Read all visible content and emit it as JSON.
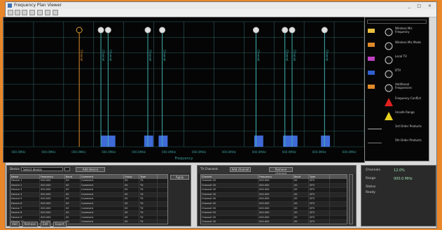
{
  "window": {
    "title": "Frequency Plan Viewer",
    "controls": "_ □ ×"
  },
  "toolbar": {
    "buttons": [
      "open-icon",
      "save-icon",
      "print-icon",
      "zoom-in-icon",
      "zoom-out-icon",
      "refresh-icon",
      "settings-icon"
    ]
  },
  "plot": {
    "x_axis_title": "Frequency",
    "tick_labels": [
      "000.0MHz",
      "000.0MHz",
      "000.0MHz",
      "000.0MHz",
      "000.0MHz",
      "000.0MHz",
      "000.0MHz",
      "000.0MHz",
      "000.0MHz",
      "000.0MHz",
      "000.0MHz",
      "000.0MHz"
    ]
  },
  "chart_data": {
    "type": "bar",
    "grid": true,
    "background": "#050505",
    "grid_color": "#2d5f5f",
    "markers": [
      {
        "x": 0.21,
        "kind": "wireless_mic",
        "color": "#e08a2a",
        "label": "Channel"
      },
      {
        "x": 0.27,
        "kind": "tv",
        "color": "#3fb0b0",
        "label": "Channel"
      },
      {
        "x": 0.29,
        "kind": "tv",
        "color": "#3fb0b0",
        "label": "Channel"
      },
      {
        "x": 0.4,
        "kind": "tv",
        "color": "#3fb0b0",
        "label": "Channel"
      },
      {
        "x": 0.44,
        "kind": "tv",
        "color": "#3fb0b0",
        "label": "Channel"
      },
      {
        "x": 0.7,
        "kind": "tv",
        "color": "#3fb0b0",
        "label": "Channel"
      },
      {
        "x": 0.78,
        "kind": "tv",
        "color": "#3fb0b0",
        "label": "Channel"
      },
      {
        "x": 0.8,
        "kind": "tv",
        "color": "#3fb0b0",
        "label": "Channel"
      },
      {
        "x": 0.89,
        "kind": "tv",
        "color": "#3fb0b0",
        "label": "Channel"
      }
    ],
    "bars": [
      {
        "x0": 0.27,
        "x1": 0.31,
        "value": 0.09
      },
      {
        "x0": 0.39,
        "x1": 0.415,
        "value": 0.09
      },
      {
        "x0": 0.43,
        "x1": 0.455,
        "value": 0.09
      },
      {
        "x0": 0.695,
        "x1": 0.72,
        "value": 0.09
      },
      {
        "x0": 0.775,
        "x1": 0.815,
        "value": 0.09
      },
      {
        "x0": 0.88,
        "x1": 0.905,
        "value": 0.09
      }
    ]
  },
  "legend": {
    "items": [
      {
        "label": "Wireless Mic Frequency",
        "swatch": "#e8c040",
        "icon": "wireless-mic-icon"
      },
      {
        "label": "Wireless Mic Mode",
        "swatch": "#e08a2a",
        "icon": "wireless-mic-mode-icon"
      },
      {
        "label": "Local TV",
        "swatch": "#c040c0",
        "icon": "tv-icon"
      },
      {
        "label": "DTV",
        "swatch": "#3060d0",
        "icon": "dtv-icon"
      },
      {
        "label": "Additional Frequencies",
        "swatch": "#e08a2a",
        "icon": "additional-freq-icon"
      },
      {
        "label": "Frequency Conflict",
        "swatch": "",
        "icon": "conflict-warning-icon"
      },
      {
        "label": "Unsafe Range",
        "swatch": "",
        "icon": "caution-icon"
      },
      {
        "label": "3rd Order Products",
        "swatch": "#b0b0b0",
        "icon": ""
      },
      {
        "label": "5th Order Products",
        "swatch": "#7a7a7a",
        "icon": ""
      }
    ]
  },
  "left_panel": {
    "field_label": "Device",
    "field_value": "Select device",
    "action_label": "Add device",
    "side_button": "Apply",
    "columns": [
      "Name",
      "Frequency",
      "Band",
      "Comment",
      "Group",
      "Type"
    ],
    "rows": [
      [
        "Device 1",
        "000.000",
        "00",
        "Comment",
        "00",
        "TX"
      ],
      [
        "Device 2",
        "000.000",
        "00",
        "Comment",
        "00",
        "TX"
      ],
      [
        "Device 3",
        "000.000",
        "00",
        "Comment",
        "00",
        "TX"
      ],
      [
        "Device 4",
        "000.000",
        "00",
        "Comment",
        "00",
        "TX"
      ],
      [
        "Device 5",
        "000.000",
        "00",
        "Comment",
        "00",
        "TX"
      ],
      [
        "Device 6",
        "000.000",
        "00",
        "Comment",
        "00",
        "TX"
      ],
      [
        "Device 7",
        "000.000",
        "00",
        "Comment",
        "00",
        "TX"
      ],
      [
        "Device 8",
        "000.000",
        "00",
        "Comment",
        "00",
        "TX"
      ],
      [
        "Device 9",
        "000.000",
        "00",
        "Comment",
        "00",
        "TX"
      ],
      [
        "Device 10",
        "000.000",
        "00",
        "Comment",
        "00",
        "TX"
      ]
    ],
    "footer_buttons": [
      "Add",
      "Remove",
      "Edit",
      "Export"
    ]
  },
  "middle_panel": {
    "header_label": "TV Channels",
    "button1": "Add channel",
    "button2": "Remove channel",
    "columns": [
      "Channel",
      "Frequency",
      "Band",
      "Type"
    ],
    "rows": [
      [
        "Channel 00",
        "000.000",
        "00",
        "DTV"
      ],
      [
        "Channel 00",
        "000.000",
        "00",
        "DTV"
      ],
      [
        "Channel 00",
        "000.000",
        "00",
        "DTV"
      ],
      [
        "Channel 00",
        "000.000",
        "00",
        "DTV"
      ],
      [
        "Channel 00",
        "000.000",
        "00",
        "DTV"
      ],
      [
        "Channel 00",
        "000.000",
        "00",
        "DTV"
      ],
      [
        "Channel 00",
        "000.000",
        "00",
        "DTV"
      ],
      [
        "Channel 00",
        "000.000",
        "00",
        "DTV"
      ],
      [
        "Channel 00",
        "000.000",
        "00",
        "DTV"
      ],
      [
        "Channel 00",
        "000.000",
        "00",
        "DTV"
      ]
    ]
  },
  "right_panel": {
    "stat1_label": "Channels",
    "stat1_value": "12.0%",
    "stat2_label": "Range",
    "stat2_value": "000.0 MHz",
    "stat3_label": "Status",
    "stat3_value": "Ready"
  }
}
